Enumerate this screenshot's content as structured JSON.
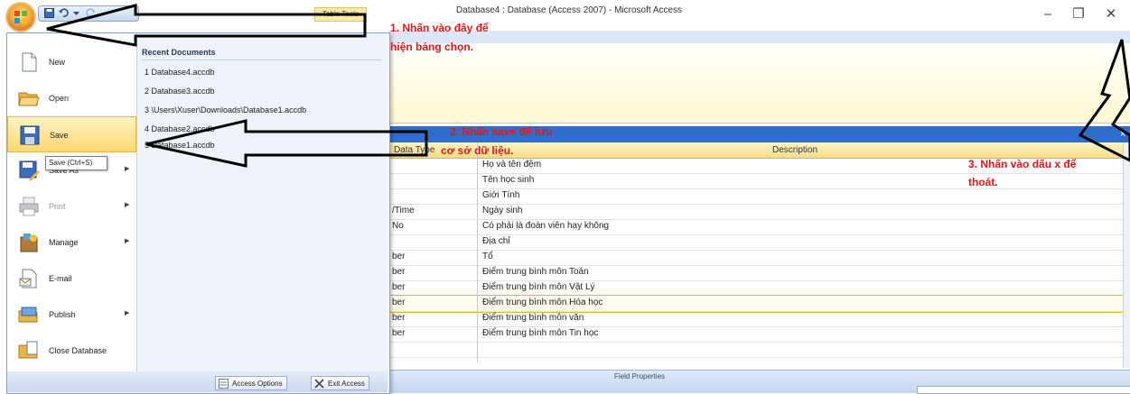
{
  "window": {
    "app_title": "Database4 : Database (Access 2007) - Microsoft Access",
    "contextual_tab": "Table Tools",
    "minimize_glyph": "–",
    "restore_glyph": "❐",
    "close_glyph": "✕"
  },
  "office_menu": {
    "items": [
      {
        "label": "New",
        "icon": "new-document-icon",
        "has_submenu": false
      },
      {
        "label": "Open",
        "icon": "open-folder-icon",
        "has_submenu": false
      },
      {
        "label": "Save",
        "icon": "save-icon",
        "has_submenu": false,
        "highlighted": true
      },
      {
        "label": "Save As",
        "icon": "save-as-icon",
        "has_submenu": true
      },
      {
        "label": "Print",
        "icon": "print-icon",
        "has_submenu": true,
        "disabled": true
      },
      {
        "label": "Manage",
        "icon": "manage-icon",
        "has_submenu": true
      },
      {
        "label": "E-mail",
        "icon": "email-icon",
        "has_submenu": false
      },
      {
        "label": "Publish",
        "icon": "publish-icon",
        "has_submenu": true
      },
      {
        "label": "Close Database",
        "icon": "close-database-icon",
        "has_submenu": false
      }
    ],
    "tooltip": "Save (Ctrl+S)",
    "recent_title": "Recent Documents",
    "recent_documents": [
      "1 Database4.accdb",
      "2 Database3.accdb",
      "3 \\Users\\Xuser\\Downloads\\Database1.accdb",
      "4 Database2.accdb",
      "5 Database1.accdb"
    ],
    "footer": {
      "access_options": "Access Options",
      "exit_access": "Exit Access"
    }
  },
  "table_design": {
    "column_data_type": "Data Type",
    "column_description": "Description",
    "rows": [
      {
        "data_type": "",
        "description": "Họ và tên đệm"
      },
      {
        "data_type": "",
        "description": "Tên học sinh"
      },
      {
        "data_type": "",
        "description": "Giới Tính"
      },
      {
        "data_type": "/Time",
        "description": "Ngày sinh"
      },
      {
        "data_type": "No",
        "description": "Có phải là đoàn viên hay không"
      },
      {
        "data_type": "",
        "description": "Địa chỉ"
      },
      {
        "data_type": "ber",
        "description": "Tổ"
      },
      {
        "data_type": "ber",
        "description": "Điểm trung bình môn Toán"
      },
      {
        "data_type": "ber",
        "description": "Điểm trung bình môn Vật Lý"
      },
      {
        "data_type": "ber",
        "description": "Điểm trung bình môn Hóa học",
        "selected": true
      },
      {
        "data_type": "ber",
        "description": "Điểm trung bình môn văn"
      },
      {
        "data_type": "ber",
        "description": "Điểm trung bình môn Tin học"
      }
    ],
    "field_properties_label": "Field Properties",
    "close_glyph": "×"
  },
  "annotations": {
    "step1_line1": "1. Nhấn vào đây để",
    "step1_line2": "hiện bảng chọn.",
    "step2_line1": "2. Nhấn save để lưu",
    "step2_line2": "cơ sở dữ liệu.",
    "step3_line1": "3. Nhấn vào dấu x để",
    "step3_line2": "thoát.",
    "color": "#e01818"
  },
  "colors": {
    "ribbon_blue": "#2f6fc9",
    "highlight": "#ffd774"
  }
}
